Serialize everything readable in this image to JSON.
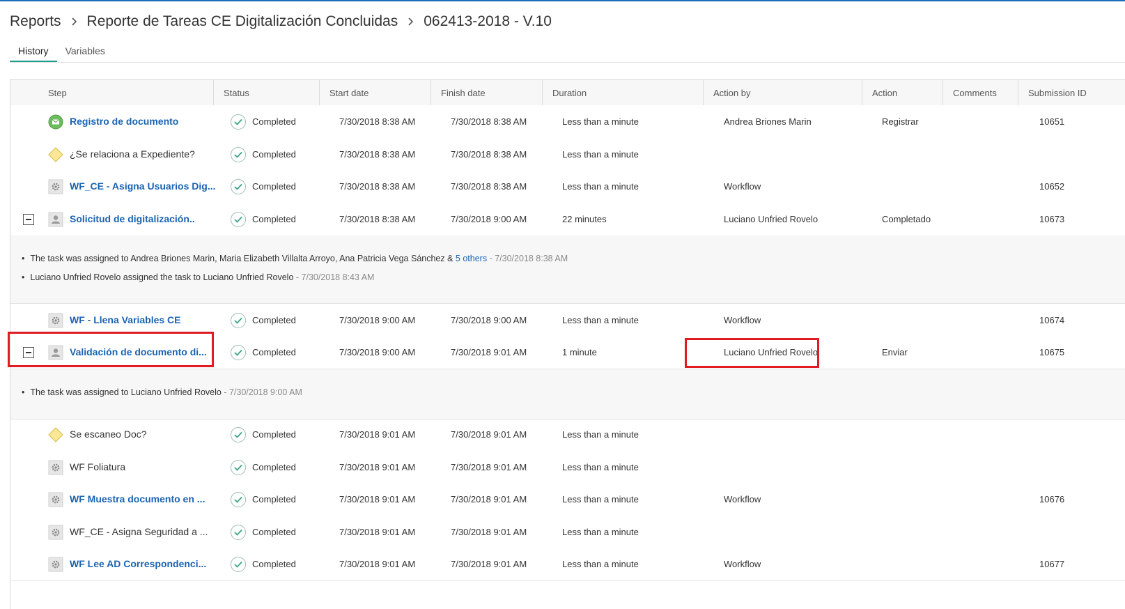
{
  "breadcrumb": {
    "root": "Reports",
    "report": "Reporte de Tareas CE Digitalización Concluidas",
    "instance": "062413-2018 - V.10"
  },
  "tabs": [
    {
      "label": "History",
      "active": true
    },
    {
      "label": "Variables",
      "active": false
    }
  ],
  "columns": {
    "step": "Step",
    "status": "Status",
    "start": "Start date",
    "finish": "Finish date",
    "duration": "Duration",
    "action_by": "Action by",
    "action": "Action",
    "comments": "Comments",
    "submission": "Submission ID"
  },
  "rows": [
    {
      "step": "Registro de documento",
      "icon": "start-envelope-icon",
      "link": true,
      "status": "Completed",
      "start": "7/30/2018 8:38 AM",
      "finish": "7/30/2018 8:38 AM",
      "duration": "Less than a minute",
      "action_by": "Andrea Briones Marin",
      "action": "Registrar",
      "comments": "",
      "submission": "10651"
    },
    {
      "step": "¿Se relaciona a Expediente?",
      "icon": "decision-diamond-icon",
      "link": false,
      "status": "Completed",
      "start": "7/30/2018 8:38 AM",
      "finish": "7/30/2018 8:38 AM",
      "duration": "Less than a minute",
      "action_by": "",
      "action": "",
      "comments": "",
      "submission": ""
    },
    {
      "step": "WF_CE - Asigna Usuarios Dig...",
      "icon": "gear-icon",
      "link": true,
      "status": "Completed",
      "start": "7/30/2018 8:38 AM",
      "finish": "7/30/2018 8:38 AM",
      "duration": "Less than a minute",
      "action_by": "Workflow",
      "action": "",
      "comments": "",
      "submission": "10652"
    },
    {
      "step": "Solicitud de digitalización..",
      "icon": "user-icon",
      "link": true,
      "status": "Completed",
      "start": "7/30/2018 8:38 AM",
      "finish": "7/30/2018 9:00 AM",
      "duration": "22 minutes",
      "action_by": "Luciano Unfried Rovelo",
      "action": "Completado",
      "comments": "",
      "submission": "10673"
    },
    {
      "step": "WF - Llena Variables CE",
      "icon": "gear-icon",
      "link": true,
      "status": "Completed",
      "start": "7/30/2018 9:00 AM",
      "finish": "7/30/2018 9:00 AM",
      "duration": "Less than a minute",
      "action_by": "Workflow",
      "action": "",
      "comments": "",
      "submission": "10674"
    },
    {
      "step": "Validación de documento di...",
      "icon": "user-icon",
      "link": true,
      "status": "Completed",
      "start": "7/30/2018 9:00 AM",
      "finish": "7/30/2018 9:01 AM",
      "duration": "1 minute",
      "action_by": "Luciano Unfried Rovelo",
      "action": "Enviar",
      "comments": "",
      "submission": "10675"
    },
    {
      "step": "Se escaneo Doc?",
      "icon": "decision-diamond-icon",
      "link": false,
      "status": "Completed",
      "start": "7/30/2018 9:01 AM",
      "finish": "7/30/2018 9:01 AM",
      "duration": "Less than a minute",
      "action_by": "",
      "action": "",
      "comments": "",
      "submission": ""
    },
    {
      "step": "WF Foliatura",
      "icon": "gear-icon",
      "link": false,
      "status": "Completed",
      "start": "7/30/2018 9:01 AM",
      "finish": "7/30/2018 9:01 AM",
      "duration": "Less than a minute",
      "action_by": "",
      "action": "",
      "comments": "",
      "submission": ""
    },
    {
      "step": "WF Muestra documento en ...",
      "icon": "gear-icon",
      "link": true,
      "status": "Completed",
      "start": "7/30/2018 9:01 AM",
      "finish": "7/30/2018 9:01 AM",
      "duration": "Less than a minute",
      "action_by": "Workflow",
      "action": "",
      "comments": "",
      "submission": "10676"
    },
    {
      "step": "WF_CE - Asigna Seguridad a ...",
      "icon": "gear-icon",
      "link": false,
      "status": "Completed",
      "start": "7/30/2018 9:01 AM",
      "finish": "7/30/2018 9:01 AM",
      "duration": "Less than a minute",
      "action_by": "",
      "action": "",
      "comments": "",
      "submission": ""
    },
    {
      "step": "WF Lee AD Correspondenci...",
      "icon": "gear-icon",
      "link": true,
      "status": "Completed",
      "start": "7/30/2018 9:01 AM",
      "finish": "7/30/2018 9:01 AM",
      "duration": "Less than a minute",
      "action_by": "Workflow",
      "action": "",
      "comments": "",
      "submission": "10677"
    }
  ],
  "details": {
    "solicitud": {
      "line1_text": "The task was assigned to Andrea Briones Marin, Maria Elizabeth Villalta Arroyo, Ana Patricia Vega Sánchez & ",
      "line1_link": "5 others",
      "line1_time": " - 7/30/2018 8:38 AM",
      "line2_text": "Luciano Unfried Rovelo assigned the task to Luciano Unfried Rovelo",
      "line2_time": " - 7/30/2018 8:43 AM"
    },
    "validacion": {
      "line1_text": "The task was assigned to Luciano Unfried Rovelo",
      "line1_time": " - 7/30/2018 9:00 AM"
    }
  },
  "colors": {
    "link": "#1a63b3",
    "tab_active": "#1a9e8a",
    "highlight": "#e01b22",
    "check": "#3aa386",
    "top_line": "#1e6fb8"
  }
}
